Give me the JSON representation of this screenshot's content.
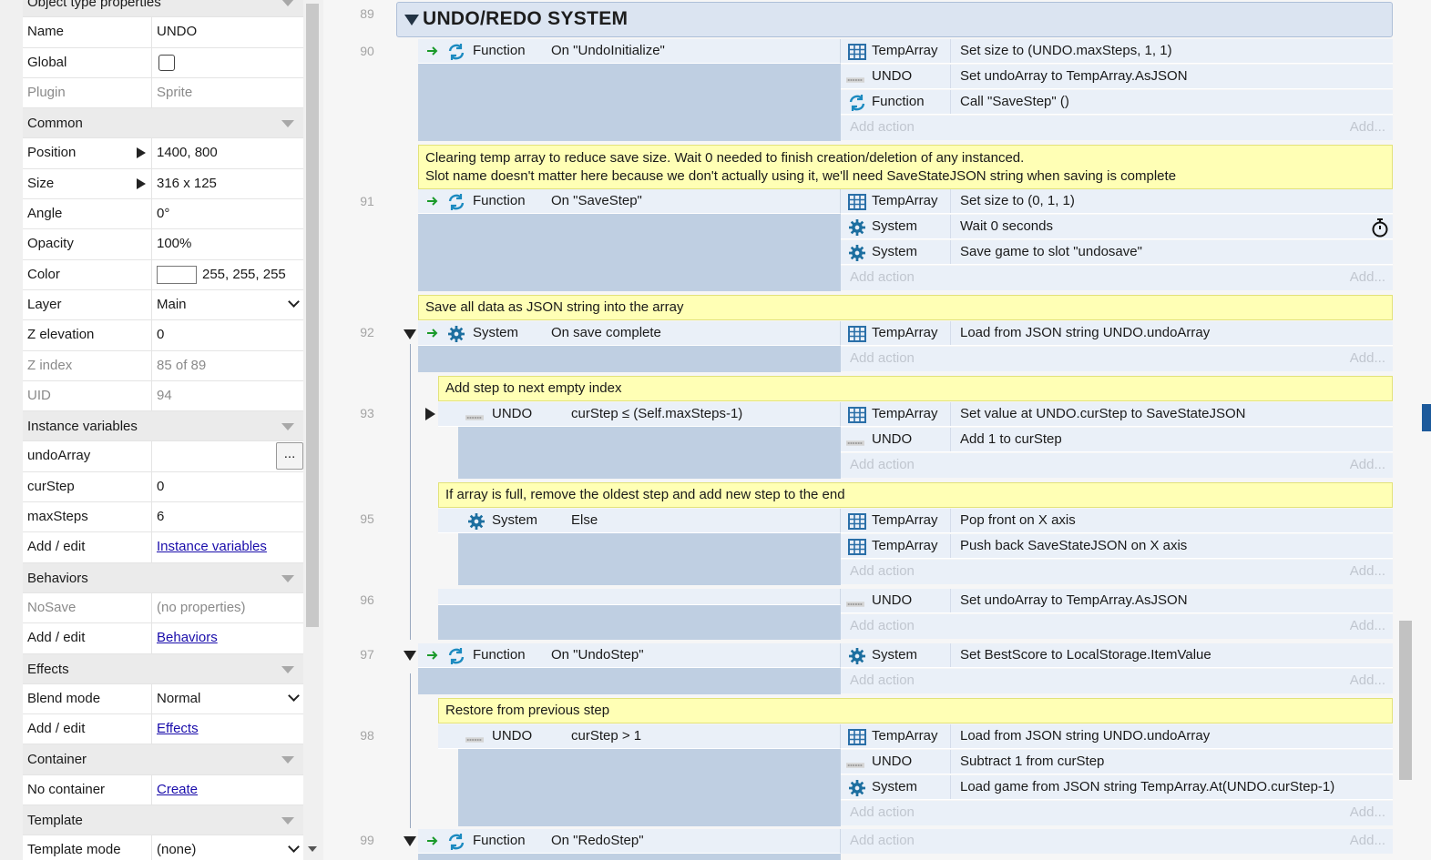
{
  "props": {
    "rows": [
      {
        "type": "section",
        "label": "Object type properties"
      },
      {
        "key": "Name",
        "value": "UNDO"
      },
      {
        "key": "Global",
        "checkbox": true
      },
      {
        "key": "Plugin",
        "value": "Sprite",
        "disabled": true
      },
      {
        "type": "section",
        "label": "Common"
      },
      {
        "key": "Position",
        "value": "1400, 800",
        "expand": true
      },
      {
        "key": "Size",
        "value": "316 x 125",
        "expand": true
      },
      {
        "key": "Angle",
        "value": "0°"
      },
      {
        "key": "Opacity",
        "value": "100%"
      },
      {
        "key": "Color",
        "value": "255, 255, 255",
        "swatch": "#ffffff"
      },
      {
        "key": "Layer",
        "value": "Main",
        "dropdown": true
      },
      {
        "key": "Z elevation",
        "value": "0"
      },
      {
        "key": "Z index",
        "value": "85 of 89",
        "disabled": true
      },
      {
        "key": "UID",
        "value": "94",
        "disabled": true
      },
      {
        "type": "section",
        "label": "Instance variables"
      },
      {
        "key": "undoArray",
        "value": "",
        "button": "..."
      },
      {
        "key": "curStep",
        "value": "0"
      },
      {
        "key": "maxSteps",
        "value": "6"
      },
      {
        "key": "Add / edit",
        "link": "Instance variables"
      },
      {
        "type": "section",
        "label": "Behaviors"
      },
      {
        "key": "NoSave",
        "value": "(no properties)",
        "disabled": true
      },
      {
        "key": "Add / edit",
        "link": "Behaviors"
      },
      {
        "type": "section",
        "label": "Effects"
      },
      {
        "key": "Blend mode",
        "value": "Normal",
        "dropdown": true
      },
      {
        "key": "Add / edit",
        "link": "Effects"
      },
      {
        "type": "section",
        "label": "Container"
      },
      {
        "key": "No container",
        "link": "Create"
      },
      {
        "type": "section",
        "label": "Template"
      },
      {
        "key": "Template mode",
        "value": "(none)",
        "dropdown": true
      }
    ]
  },
  "sheet": {
    "group_title": "UNDO/REDO SYSTEM",
    "add_action": "Add action",
    "add_short": "Add...",
    "line_numbers": {
      "l89": "89",
      "l90": "90",
      "l91": "91",
      "l92": "92",
      "l93": "93",
      "l95": "95",
      "l96": "96",
      "l97": "97",
      "l98": "98",
      "l99": "99"
    },
    "comments": {
      "c91a": "Clearing temp array to reduce save size. Wait 0 needed to finish creation/deletion of any instanced.",
      "c91b": "Slot name doesn't matter here because we don't actually using it, we'll need SaveStateJSON string when saving is complete",
      "c92": "Save all data as JSON string into the array",
      "c93": "Add step to next empty index",
      "c95": "If array is full, remove the oldest step and add new step to the end",
      "c98": "Restore from previous step"
    },
    "objects": {
      "function": "Function",
      "system": "System",
      "undo": "UNDO",
      "temparray": "TempArray"
    },
    "cond": {
      "e90": "On \"UndoInitialize\"",
      "e91": "On \"SaveStep\"",
      "e92": "On save complete",
      "e93": "curStep ≤ (Self.maxSteps-1)",
      "e95": "Else",
      "e97": "On \"UndoStep\"",
      "e98": "curStep > 1",
      "e99": "On \"RedoStep\""
    },
    "act": {
      "a90_1": "Set size to (UNDO.maxSteps, 1, 1)",
      "a90_2": "Set undoArray to TempArray.AsJSON",
      "a90_3": "Call \"SaveStep\" ()",
      "a91_1": "Set size to (0, 1, 1)",
      "a91_2": "Wait 0 seconds",
      "a91_3": "Save game to slot \"undosave\"",
      "a92_1": "Load from JSON string UNDO.undoArray",
      "a93_1": "Set value at UNDO.curStep to SaveStateJSON",
      "a93_2": "Add 1 to curStep",
      "a95_1": "Pop front on X axis",
      "a95_2": "Push back SaveStateJSON on X axis",
      "a96_1": "Set undoArray to TempArray.AsJSON",
      "a97_1": "Set BestScore to LocalStorage.ItemValue",
      "a98_1": "Load from JSON string UNDO.undoArray",
      "a98_2": "Subtract 1 from curStep",
      "a98_3": "Load game from JSON string TempArray.At(UNDO.curStep-1)"
    },
    "colors": {
      "comment": "#ffffb5",
      "event": "#bfcfe2",
      "row": "#eaf0f8",
      "accent": "#1d5a9b"
    }
  }
}
